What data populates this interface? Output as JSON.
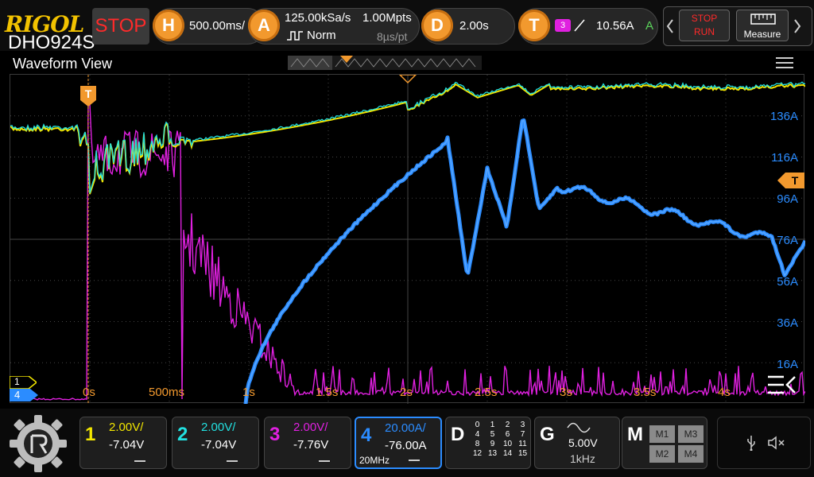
{
  "brand": {
    "logo": "RIGOL",
    "model": "DHO924S"
  },
  "status": {
    "state": "STOP"
  },
  "horizontal": {
    "badge": "H",
    "timebase": "500.00ms/"
  },
  "acquire": {
    "badge": "A",
    "sample_rate": "125.00kSa/s",
    "memory": "1.00Mpts",
    "mode": "Norm",
    "time_per_pt": "8µs/pt"
  },
  "delay": {
    "badge": "D",
    "value": "2.00s"
  },
  "trigger": {
    "badge": "T",
    "source": "3",
    "level": "10.56A",
    "mode": "A"
  },
  "controls": {
    "stop_run_top": "STOP",
    "stop_run_bottom": "RUN",
    "measure": "Measure"
  },
  "view": {
    "title": "Waveform View",
    "trigger_marker": "T",
    "right_marker": "T",
    "ch1_marker": "1",
    "ch4_marker": "4",
    "amp_labels": [
      "136A",
      "116A",
      "96A",
      "76A",
      "56A",
      "36A",
      "16A"
    ],
    "time_labels": [
      "0s",
      "500ms",
      "1s",
      "1.5s",
      "2s",
      "2.5s",
      "3s",
      "3.5s",
      "4s"
    ]
  },
  "channels": [
    {
      "num": "1",
      "scale": "2.00V/",
      "offset": "-7.04V",
      "color": "#f2e600"
    },
    {
      "num": "2",
      "scale": "2.00V/",
      "offset": "-7.04V",
      "color": "#22e0e0"
    },
    {
      "num": "3",
      "scale": "2.00V/",
      "offset": "-7.76V",
      "color": "#e020e0"
    },
    {
      "num": "4",
      "scale": "20.00A/",
      "offset": "-76.00A",
      "bw": "20MHz",
      "color": "#2b8cff"
    }
  ],
  "digital": {
    "label": "D",
    "channels": [
      "0",
      "1",
      "2",
      "3",
      "4",
      "5",
      "6",
      "7",
      "8",
      "9",
      "10",
      "11",
      "12",
      "13",
      "14",
      "15"
    ]
  },
  "generator": {
    "label": "G",
    "amplitude": "5.00V",
    "frequency": "1kHz"
  },
  "math": {
    "label": "M",
    "items": [
      "M1",
      "M3",
      "M2",
      "M4"
    ]
  }
}
